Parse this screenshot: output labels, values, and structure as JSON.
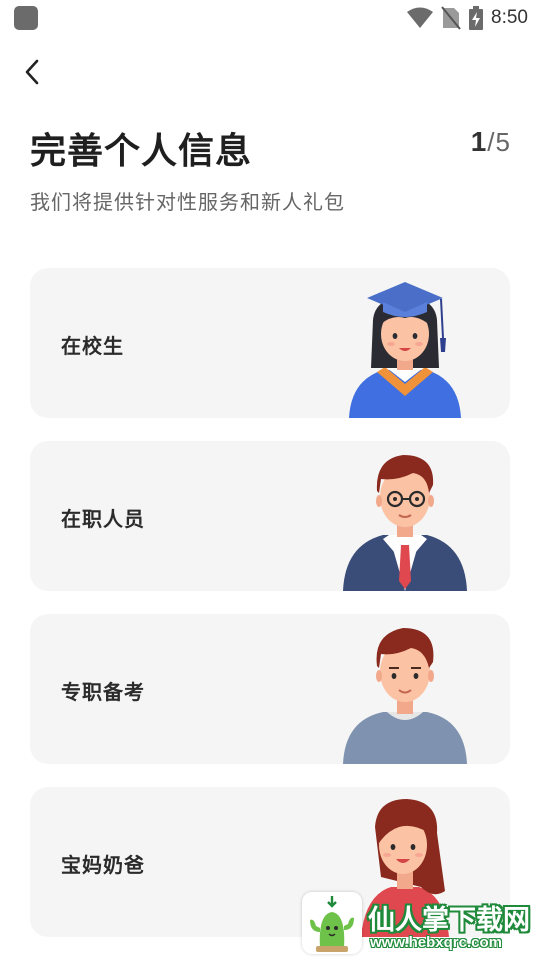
{
  "status_bar": {
    "time": "8:50",
    "icons": [
      "app-icon",
      "wifi-icon",
      "no-sim-icon",
      "battery-charging-icon"
    ]
  },
  "header": {
    "back_icon": "chevron-left-icon",
    "title": "完善个人信息",
    "subtitle": "我们将提供针对性服务和新人礼包",
    "step_current": "1",
    "step_separator": "/",
    "step_total": "5"
  },
  "options": [
    {
      "label": "在校生",
      "icon": "graduate-avatar-icon"
    },
    {
      "label": "在职人员",
      "icon": "office-worker-avatar-icon"
    },
    {
      "label": "专职备考",
      "icon": "student-man-avatar-icon"
    },
    {
      "label": "宝妈奶爸",
      "icon": "parent-woman-avatar-icon"
    }
  ],
  "watermark": {
    "title": "仙人掌下载网",
    "url": "www.hebxqrc.com",
    "logo_icon": "cactus-logo-icon"
  },
  "colors": {
    "card_background": "#f5f5f5",
    "title_text": "#1f1f1f",
    "subtitle_text": "#666666",
    "graduate_gown": "#3f6fe0",
    "graduate_collar": "#f0923a",
    "suit_navy": "#3a4d78",
    "tie_red": "#e0484f",
    "sweater_gray": "#7f93b0",
    "hair_brown": "#8a2a1e",
    "skin": "#fbc2a4",
    "watermark_green": "#1e8a3a"
  }
}
